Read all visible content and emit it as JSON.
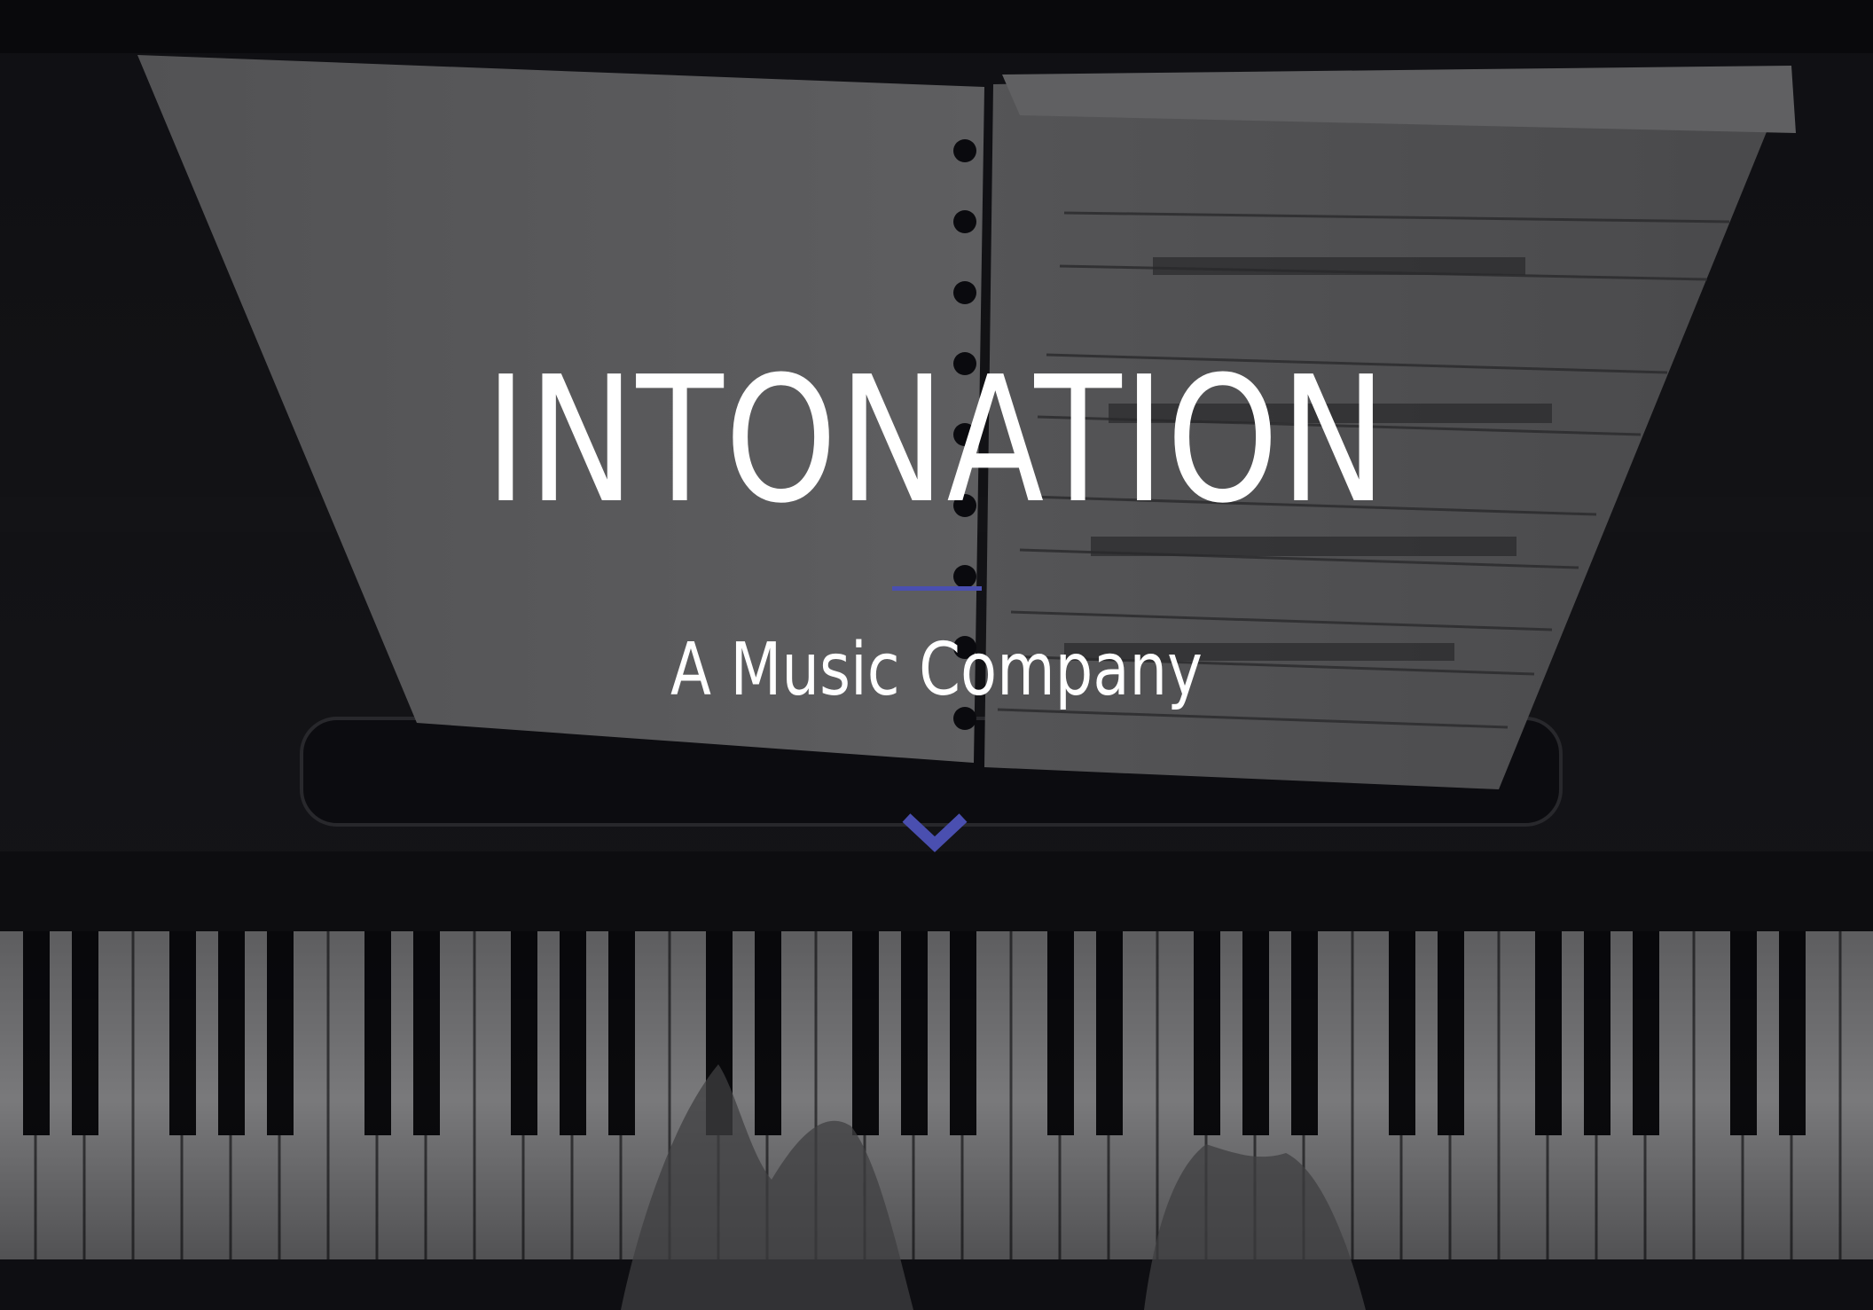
{
  "hero": {
    "title": "INTONATION",
    "subtitle": "A Music Company",
    "scroll_icon": "chevron-down-icon"
  },
  "colors": {
    "accent": "#4a4fb0",
    "text": "#ffffff",
    "background": "#0e0e10"
  }
}
